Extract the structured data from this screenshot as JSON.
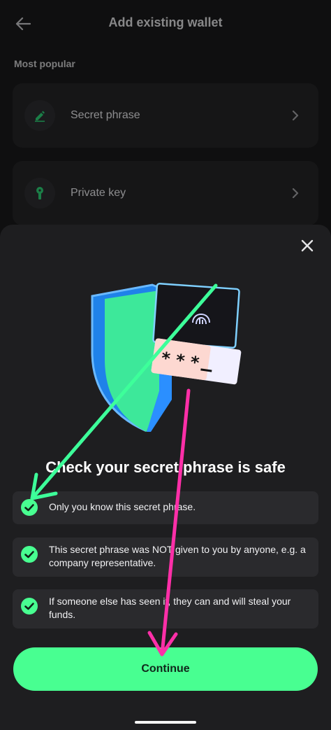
{
  "header": {
    "title": "Add existing wallet",
    "back_icon": "arrow-left-icon"
  },
  "background_list": {
    "section_label": "Most popular",
    "items": [
      {
        "label": "Secret phrase",
        "icon": "pencil-icon"
      },
      {
        "label": "Private key",
        "icon": "key-icon"
      }
    ]
  },
  "sheet": {
    "close_icon": "close-icon",
    "illustration": "shield-password-illustration",
    "title": "Check your secret phrase is safe",
    "checks": [
      {
        "text": "Only you know this secret phrase.",
        "checked": true
      },
      {
        "text": "This secret phrase was NOT given to you by anyone, e.g. a company representative.",
        "checked": true
      },
      {
        "text": "If someone else has seen it, they can and will steal your funds.",
        "checked": true
      }
    ],
    "continue_label": "Continue"
  },
  "colors": {
    "accent": "#48ff91",
    "annotation_green": "#3dff9a",
    "annotation_pink": "#ff2fa8",
    "sheet_bg": "#1e1e20",
    "card_bg": "#2a2a2d"
  }
}
